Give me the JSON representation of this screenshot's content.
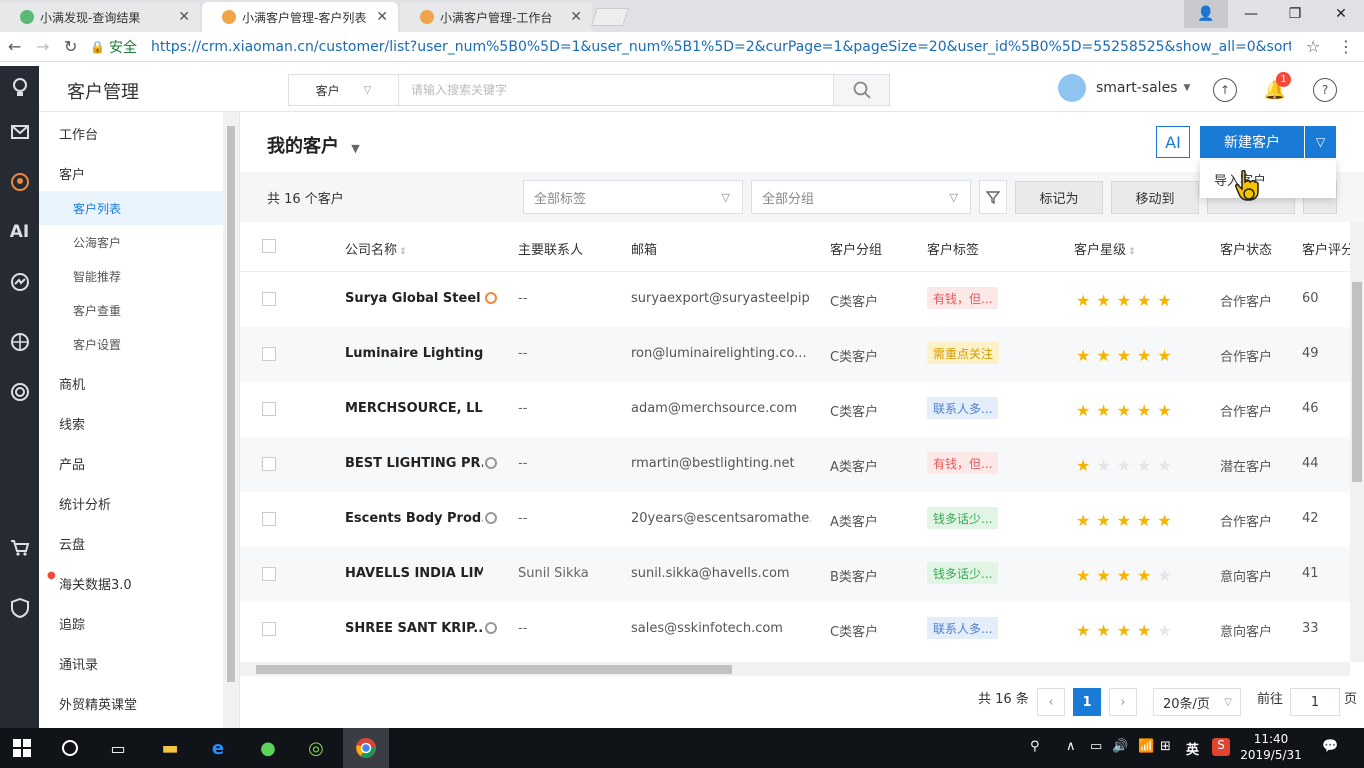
{
  "browser": {
    "tabs": [
      {
        "title": "小满发现-查询结果",
        "active": false
      },
      {
        "title": "小满客户管理-客户列表",
        "active": true
      },
      {
        "title": "小满客户管理-工作台",
        "active": false
      }
    ],
    "secure_label": "安全",
    "url": "https://crm.xiaoman.cn/customer/list?user_num%5B0%5D=1&user_num%5B1%5D=2&curPage=1&pageSize=20&user_id%5B0%5D=55258525&show_all=0&sort_field=s"
  },
  "rail": {
    "icons": [
      "bulb-icon",
      "mail-icon",
      "customer-icon",
      "ai-icon",
      "chart-icon",
      "globe-icon",
      "target-icon",
      "cart-icon",
      "shield-icon"
    ],
    "ai_label": "AI"
  },
  "header": {
    "page_title": "客户管理",
    "search_type": "客户",
    "search_placeholder": "请输入搜索关键字",
    "username": "smart-sales",
    "notification_count": "1"
  },
  "sidebar": {
    "items": [
      {
        "label": "工作台"
      },
      {
        "label": "客户"
      },
      {
        "label": "商机"
      },
      {
        "label": "线索"
      },
      {
        "label": "产品"
      },
      {
        "label": "统计分析"
      },
      {
        "label": "云盘"
      },
      {
        "label": "海关数据3.0"
      },
      {
        "label": "追踪"
      },
      {
        "label": "通讯录"
      },
      {
        "label": "外贸精英课堂"
      }
    ],
    "sub_items": [
      {
        "label": "客户列表",
        "active": true
      },
      {
        "label": "公海客户",
        "active": false
      },
      {
        "label": "智能推荐",
        "active": false
      },
      {
        "label": "客户查重",
        "active": false
      },
      {
        "label": "客户设置",
        "active": false
      }
    ]
  },
  "main": {
    "title": "我的客户",
    "ai_button": "AI",
    "new_button": "新建客户",
    "dropdown_item": "导入客户",
    "count_text": "共 16 个客户",
    "tag_filter": "全部标签",
    "group_filter": "全部分组",
    "mark_button": "标记为",
    "move_button": "移动到"
  },
  "table": {
    "columns": [
      "公司名称",
      "主要联系人",
      "邮箱",
      "客户分组",
      "客户标签",
      "客户星级",
      "客户状态",
      "客户评分"
    ],
    "rows": [
      {
        "company": "Surya Global Steel ...",
        "contact": "--",
        "email": "suryaexport@suryasteelpip...",
        "group": "C类客户",
        "tag": "有钱，但...",
        "tag_color": "red",
        "stars": 5,
        "status": "合作客户",
        "score": "60",
        "icon_color": "#f0883a"
      },
      {
        "company": "Luminaire Lighting Co...",
        "contact": "--",
        "email": "ron@luminairelighting.co...",
        "group": "C类客户",
        "tag": "需重点关注",
        "tag_color": "yellow",
        "stars": 5,
        "status": "合作客户",
        "score": "49",
        "icon_color": ""
      },
      {
        "company": "MERCHSOURCE, LLC",
        "contact": "--",
        "email": "adam@merchsource.com",
        "group": "C类客户",
        "tag": "联系人多...",
        "tag_color": "blue",
        "stars": 5,
        "status": "合作客户",
        "score": "46",
        "icon_color": ""
      },
      {
        "company": "BEST LIGHTING PR...",
        "contact": "--",
        "email": "rmartin@bestlighting.net",
        "group": "A类客户",
        "tag": "有钱，但...",
        "tag_color": "red",
        "stars": 1,
        "status": "潜在客户",
        "score": "44",
        "icon_color": "#999"
      },
      {
        "company": "Escents Body Prod...",
        "contact": "--",
        "email": "20years@escentsaromathe...",
        "group": "A类客户",
        "tag": "钱多话少...",
        "tag_color": "green",
        "stars": 5,
        "status": "合作客户",
        "score": "42",
        "icon_color": "#999"
      },
      {
        "company": "HAVELLS INDIA LIMIT...",
        "contact": "Sunil Sikka",
        "email": "sunil.sikka@havells.com",
        "group": "B类客户",
        "tag": "钱多话少...",
        "tag_color": "green",
        "stars": 4,
        "status": "意向客户",
        "score": "41",
        "icon_color": ""
      },
      {
        "company": "SHREE SANT KRIP...",
        "contact": "--",
        "email": "sales@sskinfotech.com",
        "group": "C类客户",
        "tag": "联系人多...",
        "tag_color": "blue",
        "stars": 4,
        "status": "意向客户",
        "score": "33",
        "icon_color": "#999"
      }
    ]
  },
  "pagination": {
    "total_text": "共 16 条",
    "current_page": "1",
    "page_size": "20条/页",
    "goto_label": "前往",
    "goto_value": "1",
    "page_suffix": "页"
  },
  "taskbar": {
    "time": "11:40",
    "date": "2019/5/31",
    "ime": "英"
  },
  "colors": {
    "accent": "#1a7bd7",
    "rail": "#262a33",
    "star": "#f5b400"
  }
}
